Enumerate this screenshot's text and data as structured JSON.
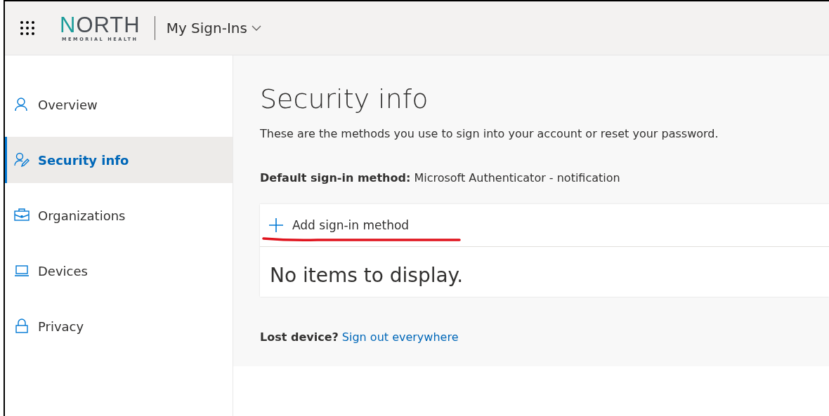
{
  "header": {
    "logo": {
      "name": "NORTH",
      "tagline": "MEMORIAL HEALTH"
    },
    "app_title": "My Sign-Ins"
  },
  "sidebar": {
    "items": [
      {
        "label": "Overview",
        "selected": false
      },
      {
        "label": "Security info",
        "selected": true
      },
      {
        "label": "Organizations",
        "selected": false
      },
      {
        "label": "Devices",
        "selected": false
      },
      {
        "label": "Privacy",
        "selected": false
      }
    ]
  },
  "main": {
    "title": "Security info",
    "description": "These are the methods you use to sign into your account or reset your password.",
    "default_method": "**Default sign-in method:** Microsoft Authenticator - notification",
    "methods_card": {
      "add_button": "Add sign-in method",
      "underlined": true,
      "empty_text": "No items to display."
    },
    "lost_device": {
      "label": "Lost device?",
      "link": "Sign out everywhere"
    }
  }
}
